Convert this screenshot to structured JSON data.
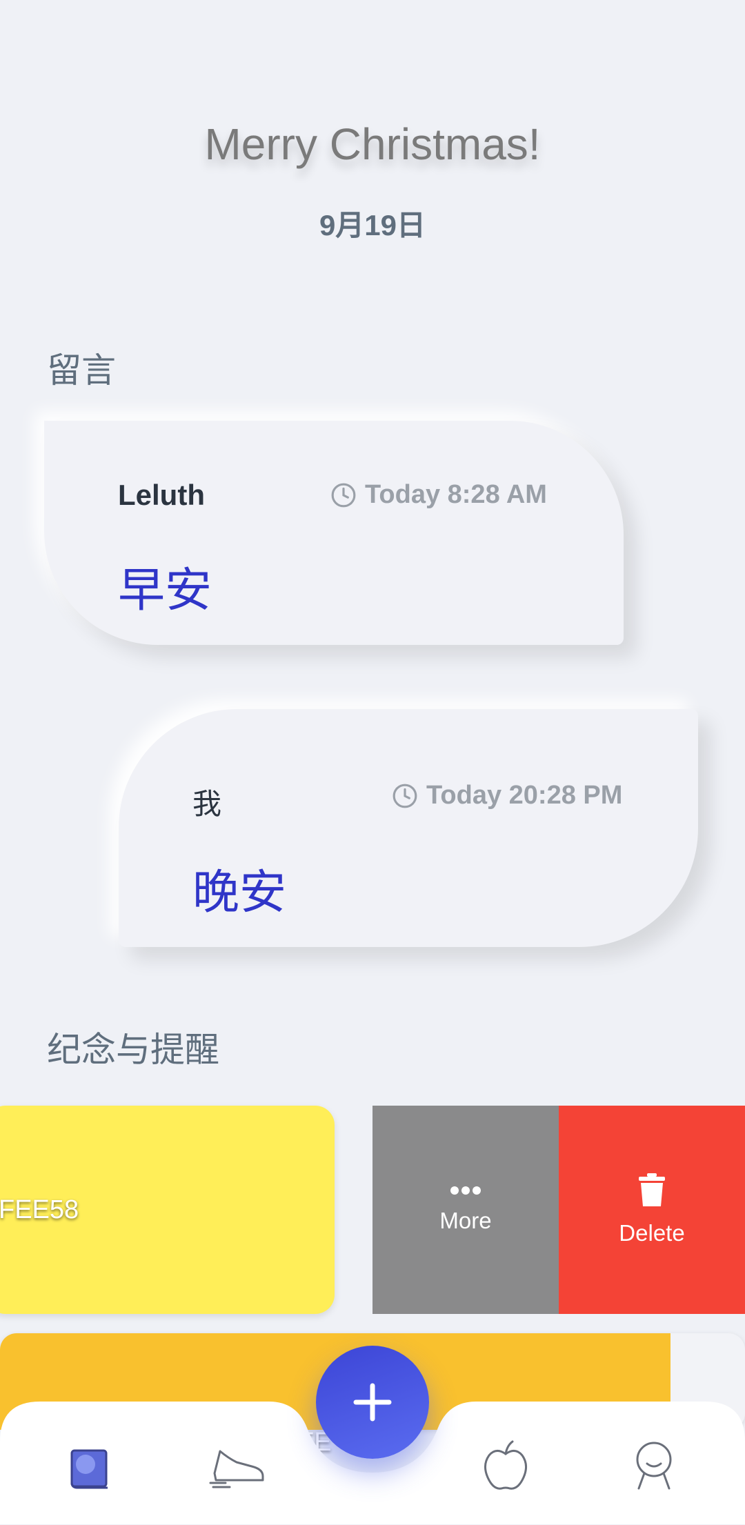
{
  "header": {
    "title": "Merry Christmas!",
    "date": "9月19日"
  },
  "messages_section": {
    "label": "留言"
  },
  "messages": [
    {
      "author": "Leluth",
      "time": "Today 8:28 AM",
      "text": "早安"
    },
    {
      "author": "我",
      "time": "Today 20:28 PM",
      "text": "晚安"
    }
  ],
  "reminders_section": {
    "label": "纪念与提醒"
  },
  "reminders": [
    {
      "hex_text": "FEE58",
      "color": "#ffee58"
    },
    {
      "partial_text": "FE",
      "color": "#f9c12e"
    }
  ],
  "swipe_actions": {
    "more_label": "More",
    "delete_label": "Delete"
  },
  "nav": {
    "items": [
      {
        "icon": "journal-icon"
      },
      {
        "icon": "sneaker-icon"
      },
      {
        "icon": "apple-icon"
      },
      {
        "icon": "profile-icon"
      }
    ],
    "fab_icon": "plus-icon"
  },
  "colors": {
    "accent": "#2f35c8",
    "fab": "#4a55e0",
    "delete": "#f44336",
    "more": "#8a8a8b"
  }
}
